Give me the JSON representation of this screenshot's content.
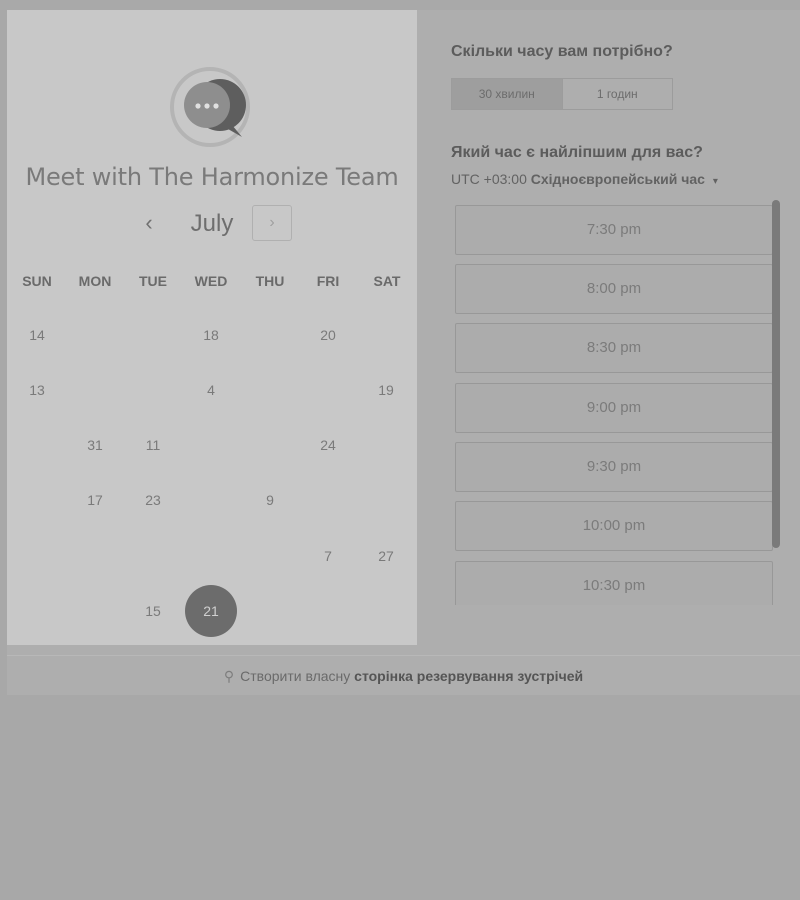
{
  "header": {
    "title": "Meet with The Harmonize Team",
    "logo_icon": "chat-bubble-logo-icon"
  },
  "calendar": {
    "month": "July",
    "prev_icon": "chevron-left-icon",
    "next_icon": "chevron-right-icon",
    "prev_glyph": "‹",
    "next_glyph": "›",
    "weekdays": [
      "SUN",
      "MON",
      "TUE",
      "WED",
      "THU",
      "FRI",
      "SAT"
    ],
    "days": [
      {
        "label": "14",
        "row": 0,
        "col": 0
      },
      {
        "label": "18",
        "row": 0,
        "col": 3
      },
      {
        "label": "20",
        "row": 0,
        "col": 5
      },
      {
        "label": "13",
        "row": 1,
        "col": 0
      },
      {
        "label": "4",
        "row": 1,
        "col": 3
      },
      {
        "label": "19",
        "row": 1,
        "col": 6
      },
      {
        "label": "31",
        "row": 2,
        "col": 1
      },
      {
        "label": "11",
        "row": 2,
        "col": 2
      },
      {
        "label": "24",
        "row": 2,
        "col": 5
      },
      {
        "label": "17",
        "row": 3,
        "col": 1
      },
      {
        "label": "23",
        "row": 3,
        "col": 2
      },
      {
        "label": "9",
        "row": 3,
        "col": 4
      },
      {
        "label": "7",
        "row": 4,
        "col": 5
      },
      {
        "label": "27",
        "row": 4,
        "col": 6
      },
      {
        "label": "15",
        "row": 5,
        "col": 2
      },
      {
        "label": "21",
        "row": 5,
        "col": 3,
        "selected": true
      }
    ]
  },
  "booking": {
    "duration_question": "Скільки часу вам потрібно?",
    "durations": [
      {
        "label": "30 хвилин",
        "active": true
      },
      {
        "label": "1 годин",
        "active": false
      }
    ],
    "time_question": "Який час є найліпшим для вас?",
    "timezone_offset": "UTC +03:00",
    "timezone_name": "Східноєвропейський час",
    "timezone_caret": "▾",
    "slots": [
      "7:30 pm",
      "8:00 pm",
      "8:30 pm",
      "9:00 pm",
      "9:30 pm",
      "10:00 pm",
      "10:30 pm"
    ]
  },
  "footer": {
    "icon": "sprocket-icon",
    "icon_glyph": "⚲",
    "prefix": "Створити власну",
    "link": "сторінка резервування зустрічей"
  },
  "colors": {
    "selected_day": "#6c6c6c",
    "panel_bg": "#c8c8c8",
    "page_bg": "#a8a8a8"
  }
}
